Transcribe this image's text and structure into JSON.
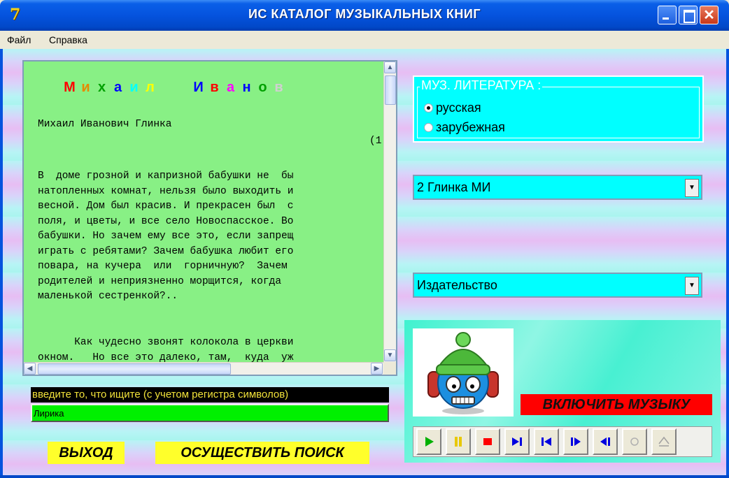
{
  "window": {
    "title": "ИС КАТАЛОГ МУЗЫКАЛЬНЫХ КНИГ",
    "close_glyph": "✕"
  },
  "menu": {
    "file": "Файл",
    "help": "Справка"
  },
  "memo": {
    "heading_letters": [
      {
        "ch": "М",
        "color": "#ff0000"
      },
      {
        "ch": "и",
        "color": "#e68a00"
      },
      {
        "ch": "х",
        "color": "#00a000"
      },
      {
        "ch": "а",
        "color": "#0000ff"
      },
      {
        "ch": "и",
        "color": "#00ffff"
      },
      {
        "ch": "л",
        "color": "#ffff00"
      },
      {
        "ch": " ",
        "color": "#000000"
      },
      {
        "ch": " ",
        "color": "#000000"
      },
      {
        "ch": "И",
        "color": "#0000ff"
      },
      {
        "ch": "в",
        "color": "#ff0000"
      },
      {
        "ch": "а",
        "color": "#ff00ff"
      },
      {
        "ch": "н",
        "color": "#0000ff"
      },
      {
        "ch": "о",
        "color": "#00a000"
      },
      {
        "ch": "в",
        "color": "#d0d0d0"
      }
    ],
    "author_line": "Михаил Иванович Глинка",
    "right_fragment": "(1",
    "paragraph_1": [
      "В  доме грозной и капризной бабушки не  бы",
      "натопленных комнат, нельзя было выходить и",
      "весной. Дом был красив. И прекрасен был  с",
      "поля, и цветы, и все село Новоспасское. Во",
      "бабушки. Но зачем ему все это, если запрещ",
      "играть с ребятами? Зачем бабушка любит его",
      "повара, на кучера  или  горничную?  Зачем",
      "родителей и неприязненно морщится, когда",
      "маленькой сестренкой?.."
    ],
    "paragraph_2": [
      "      Как чудесно звонят колокола в церкви",
      "окном.   Но все это далеко, там,  куда  уж"
    ]
  },
  "search": {
    "label": "введите то, что ищите (с учетом регистра символов)",
    "value": "Лирика",
    "exit_label": "ВЫХОД",
    "search_label": "ОСУЩЕСТВИТЬ ПОИСК"
  },
  "literature": {
    "title": "МУЗ. ЛИТЕРАТУРА :",
    "options": [
      {
        "label": "русская",
        "selected": true
      },
      {
        "label": "зарубежная",
        "selected": false
      }
    ]
  },
  "composer_select": {
    "value": "2 Глинка МИ",
    "arrow": "▼"
  },
  "publisher_select": {
    "value": "Издательство",
    "arrow": "▼"
  },
  "music": {
    "toggle_label": "ВКЛЮЧИТЬ МУЗЫКУ",
    "player_buttons": [
      "play",
      "pause",
      "stop",
      "next",
      "prev",
      "step",
      "back",
      "record",
      "eject"
    ]
  },
  "colors": {
    "memo_bg": "#88f085",
    "accent_cyan": "#00ffff",
    "button_yellow": "#ffff2b",
    "music_red": "#ff0000",
    "search_green": "#00f000"
  }
}
